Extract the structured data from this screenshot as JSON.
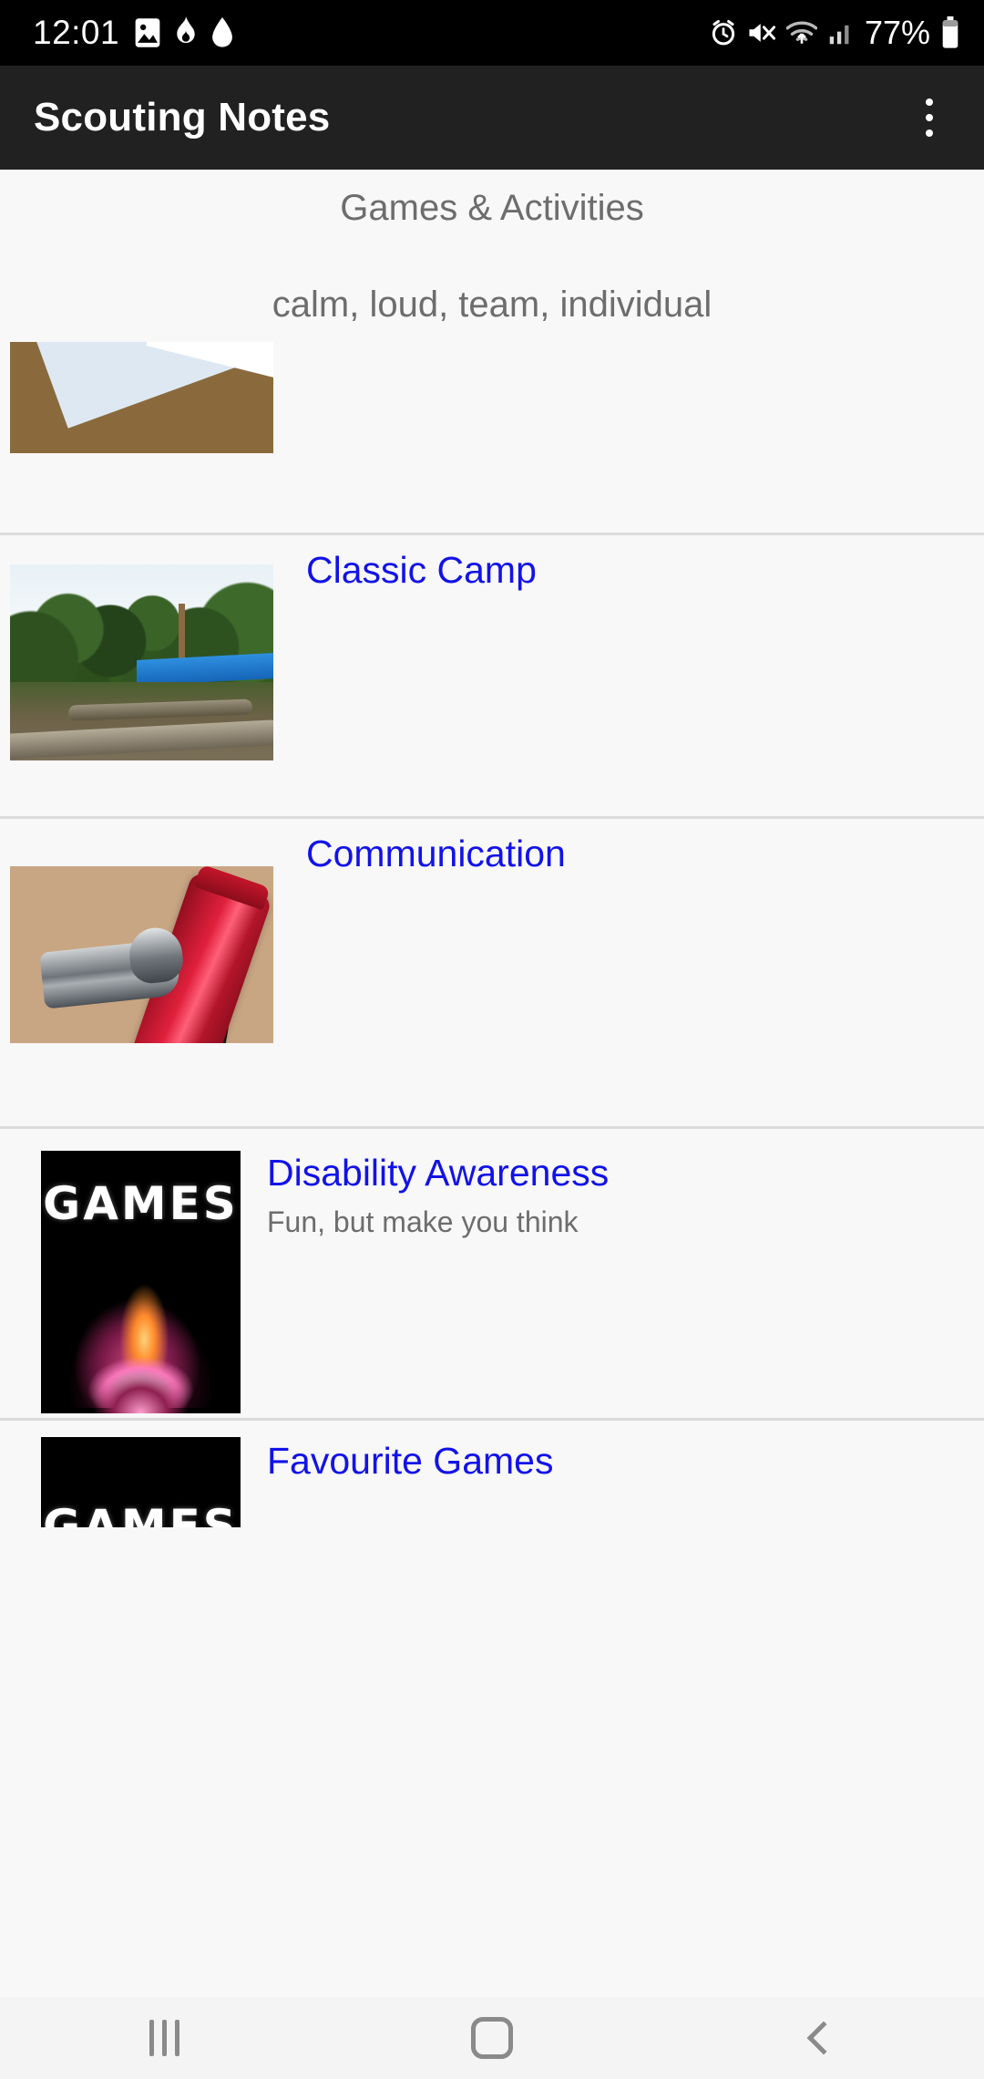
{
  "status_bar": {
    "time": "12:01",
    "battery_percent": "77%",
    "left_icons": [
      "image-icon",
      "flame-icon",
      "water-drop-icon"
    ],
    "right_icons": [
      "alarm-clock-icon",
      "mute-icon",
      "wifi-icon",
      "signal-icon",
      "battery-icon"
    ]
  },
  "app_bar": {
    "title": "Scouting Notes",
    "overflow_menu": "overflow-menu-icon"
  },
  "page": {
    "title": "Games & Activities",
    "subtitle": "calm, loud, team, individual"
  },
  "list": [
    {
      "title": "",
      "subtitle": "",
      "thumb": "playing-cards-photo",
      "partial": true
    },
    {
      "title": "Classic Camp",
      "subtitle": "",
      "thumb": "camp-site-photo"
    },
    {
      "title": "Communication",
      "subtitle": "",
      "thumb": "whistle-and-torch-photo"
    },
    {
      "title": "Disability Awareness",
      "subtitle": "Fun, but make you think",
      "thumb": "games-campfire-photo",
      "thumb_text": "GAMES"
    },
    {
      "title": "Favourite Games",
      "subtitle": "",
      "thumb": "games-campfire-photo",
      "thumb_text": "GAMES"
    }
  ],
  "nav_bar": {
    "recent_label": "recent-apps-icon",
    "home_label": "home-icon",
    "back_label": "back-icon"
  },
  "colors": {
    "link": "#1212e8",
    "muted_text": "#6d6d6d",
    "app_bar_bg": "#212121",
    "status_bar_bg": "#000000",
    "content_bg": "#f8f8f8",
    "divider": "#dcdcdc"
  }
}
